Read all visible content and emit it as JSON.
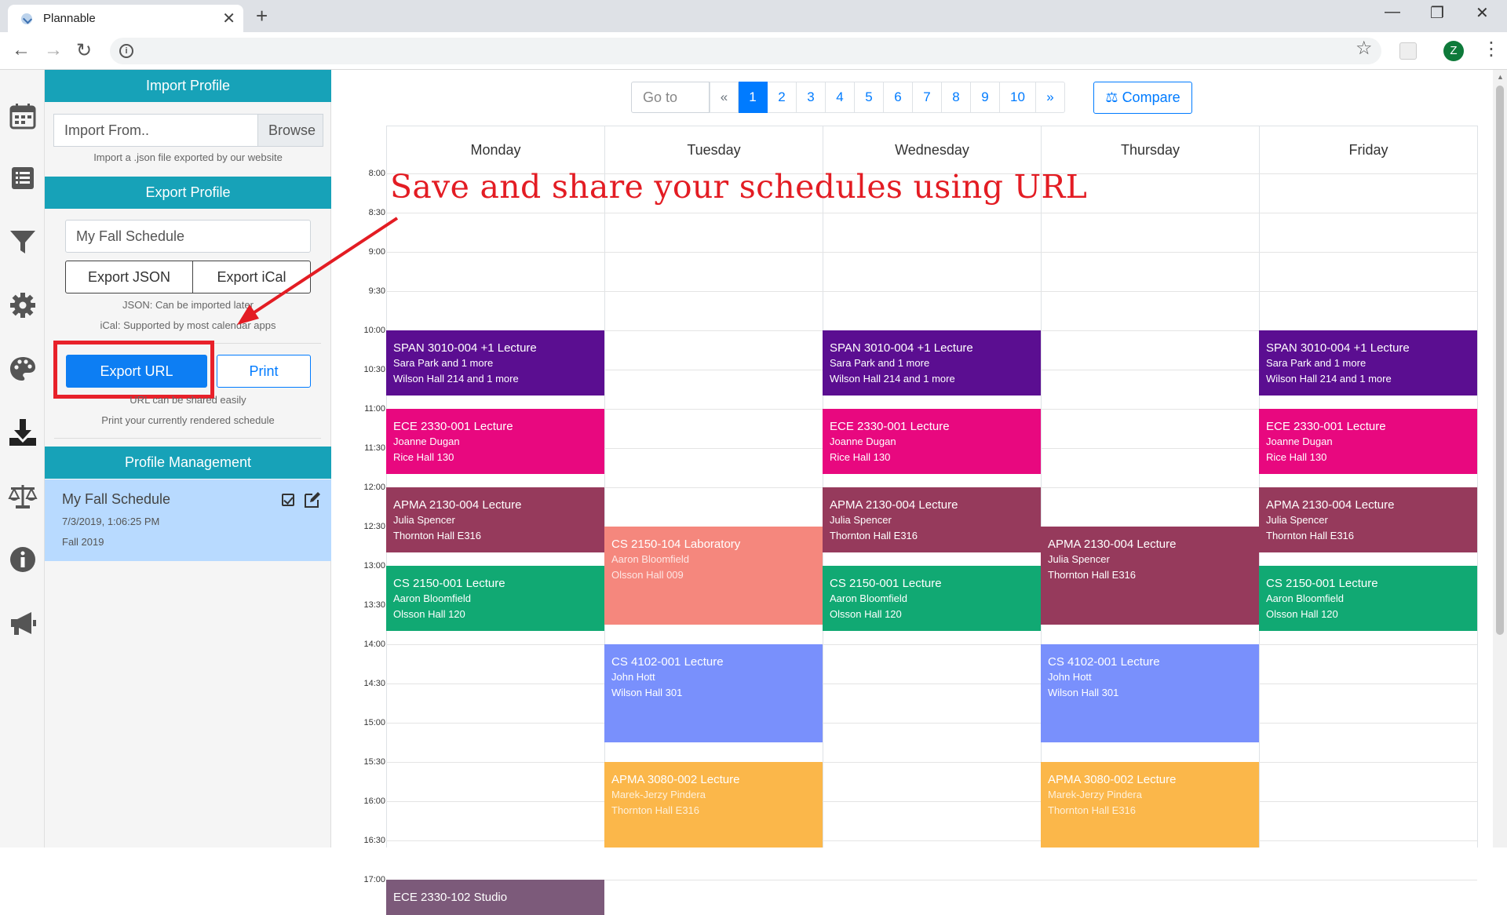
{
  "browser": {
    "tab_title": "Plannable",
    "profile_initial": "Z"
  },
  "import_profile": {
    "header": "Import Profile",
    "input_placeholder": "Import From..",
    "browse_label": "Browse",
    "hint": "Import a .json file exported by our website"
  },
  "export_profile": {
    "header": "Export Profile",
    "name_value": "My Fall Schedule",
    "export_json_label": "Export JSON",
    "export_ical_label": "Export iCal",
    "json_hint": "JSON: Can be imported later",
    "ical_hint": "iCal: Supported by most calendar apps",
    "export_url_label": "Export URL",
    "print_label": "Print",
    "url_hint": "URL can be shared easily",
    "print_hint": "Print your currently rendered schedule"
  },
  "profile_management": {
    "header": "Profile Management",
    "profile": {
      "name": "My Fall Schedule",
      "modified": "7/3/2019, 1:06:25 PM",
      "semester": "Fall 2019"
    }
  },
  "pager": {
    "goto_placeholder": "Go to",
    "prev": "«",
    "next": "»",
    "pages": [
      "1",
      "2",
      "3",
      "4",
      "5",
      "6",
      "7",
      "8",
      "9",
      "10"
    ],
    "active_page": "1",
    "compare_label": "Compare"
  },
  "calendar": {
    "days": [
      "Monday",
      "Tuesday",
      "Wednesday",
      "Thursday",
      "Friday"
    ],
    "times": [
      "8:00",
      "8:30",
      "9:00",
      "9:30",
      "10:00",
      "10:30",
      "11:00",
      "11:30",
      "12:00",
      "12:30",
      "13:00",
      "13:30",
      "14:00",
      "14:30",
      "15:00",
      "15:30",
      "16:00",
      "16:30",
      "17:00"
    ],
    "events": [
      {
        "day": 0,
        "start": "10:00",
        "end": "10:50",
        "title": "SPAN 3010-004 +1 Lecture",
        "instructor": "Sara Park and 1 more",
        "location": "Wilson Hall 214 and 1 more",
        "color": "#5b0e91"
      },
      {
        "day": 2,
        "start": "10:00",
        "end": "10:50",
        "title": "SPAN 3010-004 +1 Lecture",
        "instructor": "Sara Park and 1 more",
        "location": "Wilson Hall 214 and 1 more",
        "color": "#5b0e91"
      },
      {
        "day": 4,
        "start": "10:00",
        "end": "10:50",
        "title": "SPAN 3010-004 +1 Lecture",
        "instructor": "Sara Park and 1 more",
        "location": "Wilson Hall 214 and 1 more",
        "color": "#5b0e91"
      },
      {
        "day": 0,
        "start": "11:00",
        "end": "11:50",
        "title": "ECE 2330-001 Lecture",
        "instructor": "Joanne Dugan",
        "location": "Rice Hall 130",
        "color": "#e8087f"
      },
      {
        "day": 2,
        "start": "11:00",
        "end": "11:50",
        "title": "ECE 2330-001 Lecture",
        "instructor": "Joanne Dugan",
        "location": "Rice Hall 130",
        "color": "#e8087f"
      },
      {
        "day": 4,
        "start": "11:00",
        "end": "11:50",
        "title": "ECE 2330-001 Lecture",
        "instructor": "Joanne Dugan",
        "location": "Rice Hall 130",
        "color": "#e8087f"
      },
      {
        "day": 0,
        "start": "12:00",
        "end": "12:50",
        "title": "APMA 2130-004 Lecture",
        "instructor": "Julia Spencer",
        "location": "Thornton Hall E316",
        "color": "#963a5c"
      },
      {
        "day": 2,
        "start": "12:00",
        "end": "12:50",
        "title": "APMA 2130-004 Lecture",
        "instructor": "Julia Spencer",
        "location": "Thornton Hall E316",
        "color": "#963a5c"
      },
      {
        "day": 4,
        "start": "12:00",
        "end": "12:50",
        "title": "APMA 2130-004 Lecture",
        "instructor": "Julia Spencer",
        "location": "Thornton Hall E316",
        "color": "#963a5c"
      },
      {
        "day": 3,
        "start": "12:30",
        "end": "13:45",
        "title": "APMA 2130-004 Lecture",
        "instructor": "Julia Spencer",
        "location": "Thornton Hall E316",
        "color": "#963a5c"
      },
      {
        "day": 1,
        "start": "12:30",
        "end": "13:45",
        "title": "CS 2150-104 Laboratory",
        "instructor": "Aaron Bloomfield",
        "location": "Olsson Hall 009",
        "color": "#f5877d"
      },
      {
        "day": 0,
        "start": "13:00",
        "end": "13:50",
        "title": "CS 2150-001 Lecture",
        "instructor": "Aaron Bloomfield",
        "location": "Olsson Hall 120",
        "color": "#11a973"
      },
      {
        "day": 2,
        "start": "13:00",
        "end": "13:50",
        "title": "CS 2150-001 Lecture",
        "instructor": "Aaron Bloomfield",
        "location": "Olsson Hall 120",
        "color": "#11a973"
      },
      {
        "day": 4,
        "start": "13:00",
        "end": "13:50",
        "title": "CS 2150-001 Lecture",
        "instructor": "Aaron Bloomfield",
        "location": "Olsson Hall 120",
        "color": "#11a973"
      },
      {
        "day": 1,
        "start": "14:00",
        "end": "15:15",
        "title": "CS 4102-001 Lecture",
        "instructor": "John Hott",
        "location": "Wilson Hall 301",
        "color": "#7990fc"
      },
      {
        "day": 3,
        "start": "14:00",
        "end": "15:15",
        "title": "CS 4102-001 Lecture",
        "instructor": "John Hott",
        "location": "Wilson Hall 301",
        "color": "#7990fc"
      },
      {
        "day": 1,
        "start": "15:30",
        "end": "16:45",
        "title": "APMA 3080-002 Lecture",
        "instructor": "Marek-Jerzy Pindera",
        "location": "Thornton Hall E316",
        "color": "#fbb74a"
      },
      {
        "day": 3,
        "start": "15:30",
        "end": "16:45",
        "title": "APMA 3080-002 Lecture",
        "instructor": "Marek-Jerzy Pindera",
        "location": "Thornton Hall E316",
        "color": "#fbb74a"
      },
      {
        "day": 0,
        "start": "17:00",
        "end": "18:00",
        "title": "ECE 2330-102 Studio",
        "instructor": "",
        "location": "",
        "color": "#7c5a7a"
      }
    ]
  },
  "annotation": {
    "text": "Save and share your schedules using URL",
    "color": "#e31c23"
  },
  "rail_icons": [
    "calendar-icon",
    "list-icon",
    "filter-icon",
    "gear-icon",
    "palette-icon",
    "download-icon",
    "scale-icon",
    "info-icon",
    "megaphone-icon"
  ]
}
